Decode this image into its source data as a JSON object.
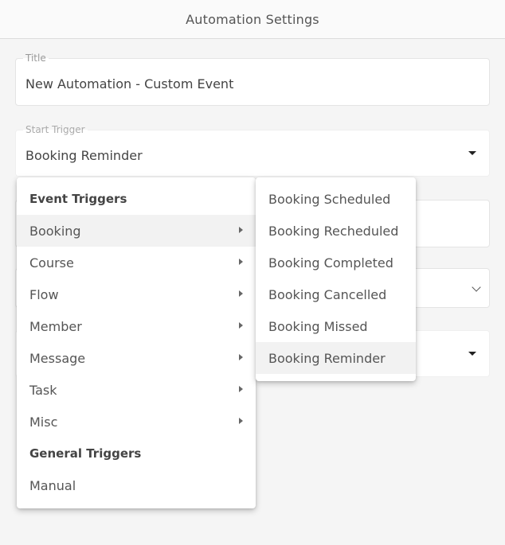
{
  "header": {
    "title": "Automation Settings"
  },
  "title_field": {
    "label": "Title",
    "value": "New Automation - Custom Event"
  },
  "start_trigger": {
    "label": "Start Trigger",
    "value": "Booking Reminder"
  },
  "trigger_menu": {
    "event_heading": "Event Triggers",
    "event_items": [
      "Booking",
      "Course",
      "Flow",
      "Member",
      "Message",
      "Task",
      "Misc"
    ],
    "general_heading": "General Triggers",
    "general_items": [
      "Manual"
    ]
  },
  "booking_submenu": {
    "items": [
      "Booking Scheduled",
      "Booking Recheduled",
      "Booking Completed",
      "Booking Cancelled",
      "Booking Missed",
      "Booking Reminder"
    ],
    "highlighted": "Booking Reminder"
  }
}
